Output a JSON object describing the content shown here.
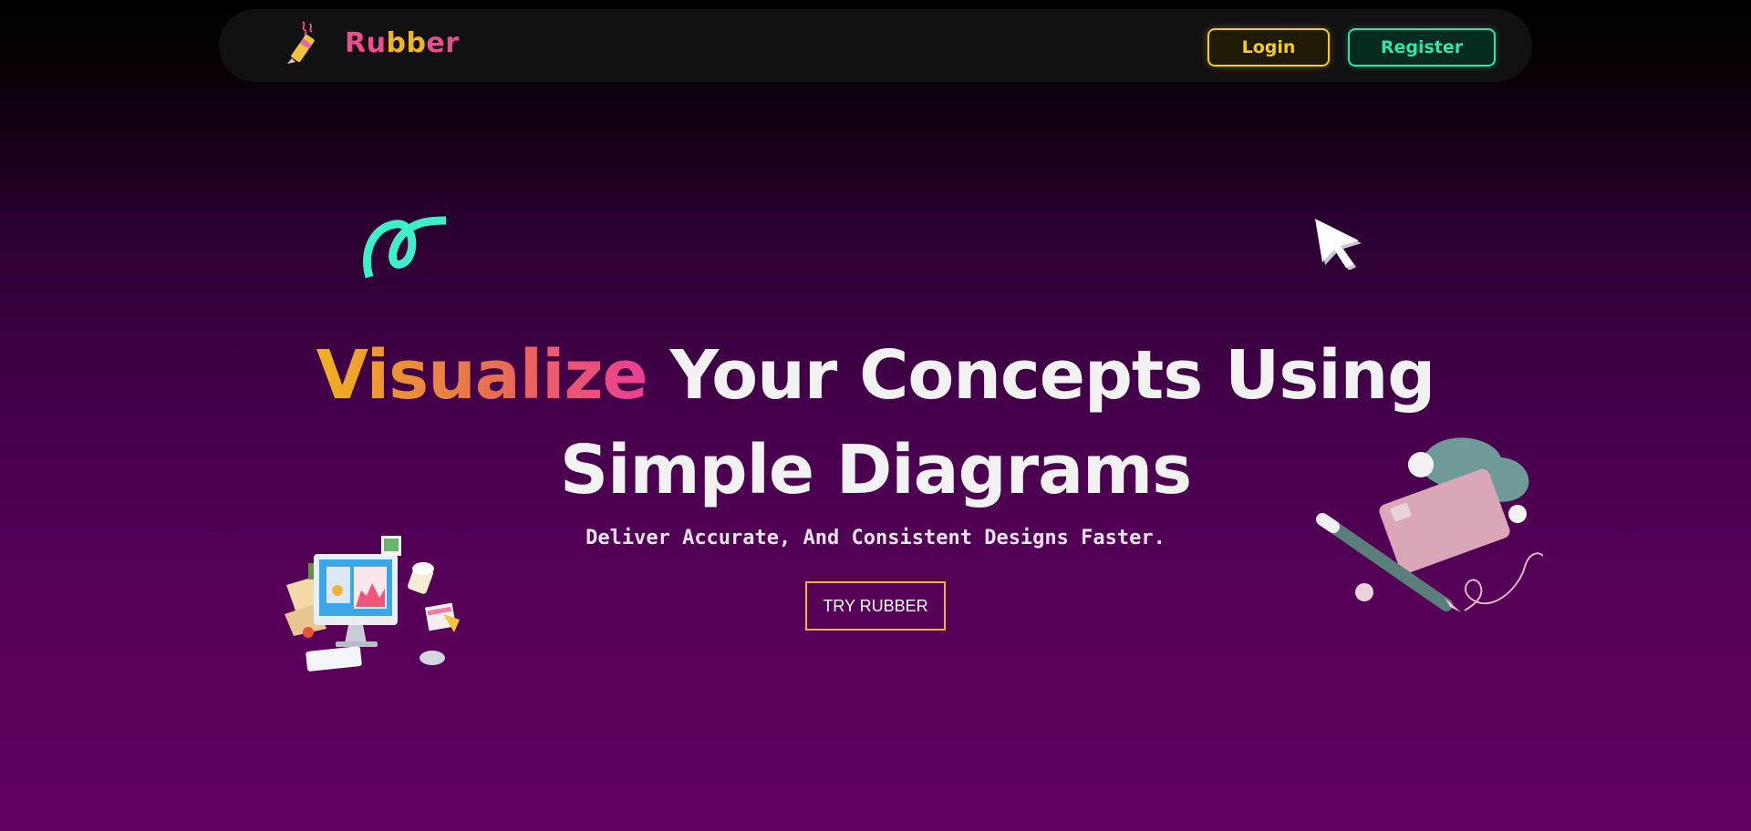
{
  "nav": {
    "brand_part1": "Ru",
    "brand_part2": "bb",
    "brand_part3": "er",
    "login_label": "Login",
    "register_label": "Register"
  },
  "hero": {
    "headline_highlight": "Visualize",
    "headline_rest": " Your Concepts Using Simple Diagrams",
    "subheadline": "Deliver Accurate, And Consistent Designs Faster.",
    "cta_label": "TRY RUBBER"
  },
  "colors": {
    "login": "#f5cf17",
    "register": "#2ee6a6",
    "brand_pink": "#ec4d8c",
    "brand_gold": "#f0b429",
    "squiggle": "#3df0c8"
  },
  "icons": [
    "crayon-logo-icon",
    "squiggle-decoration",
    "cursor-arrow-icon",
    "computer-illustration",
    "credit-card-pen-illustration"
  ]
}
